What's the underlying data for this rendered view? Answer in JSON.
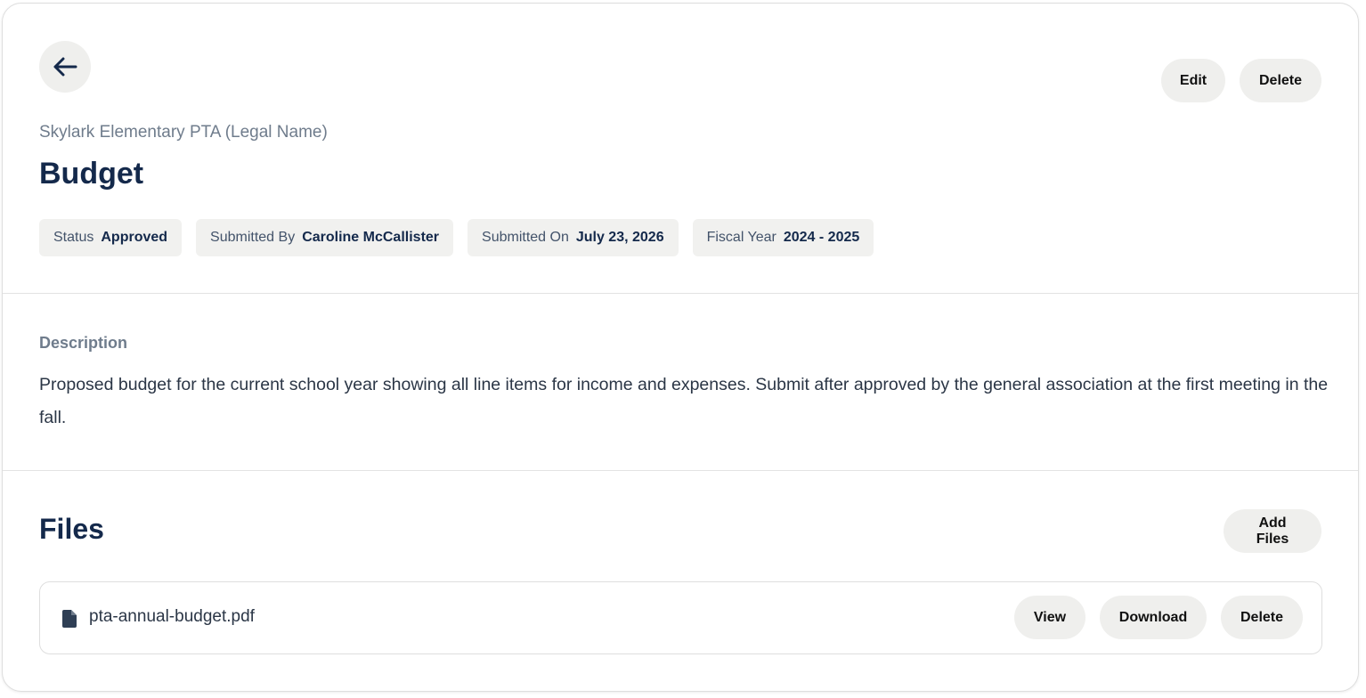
{
  "header": {
    "org_name": "Skylark Elementary PTA (Legal Name)",
    "title": "Budget",
    "edit_label": "Edit",
    "delete_label": "Delete",
    "back_icon": "arrow-left-icon"
  },
  "meta": [
    {
      "label": "Status",
      "value": "Approved"
    },
    {
      "label": "Submitted By",
      "value": "Caroline McCallister"
    },
    {
      "label": "Submitted On",
      "value": "July 23, 2026"
    },
    {
      "label": "Fiscal Year",
      "value": "2024 - 2025"
    }
  ],
  "description": {
    "label": "Description",
    "text": "Proposed budget for the current school year showing all line items for income and expenses. Submit after approved by the general association at the first meeting in the fall."
  },
  "files": {
    "title": "Files",
    "add_label": "Add Files",
    "items": [
      {
        "name": "pta-annual-budget.pdf",
        "icon": "file-icon",
        "view_label": "View",
        "download_label": "Download",
        "delete_label": "Delete"
      }
    ]
  },
  "colors": {
    "title": "#14294b",
    "muted": "#6f7c8c",
    "chip_bg": "#f1f1ef",
    "button_bg": "#efefed"
  }
}
